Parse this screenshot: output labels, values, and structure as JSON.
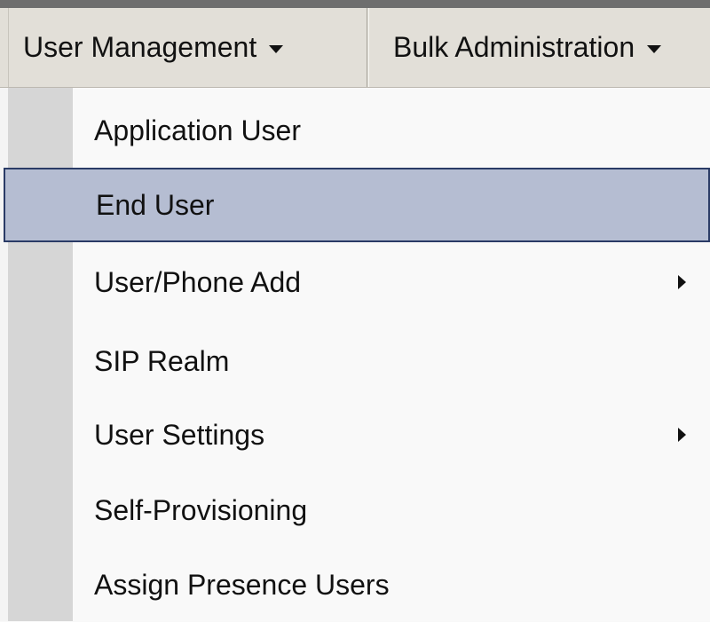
{
  "menubar": {
    "items": [
      {
        "label": "User Management",
        "has_caret": true,
        "active": true
      },
      {
        "label": "Bulk Administration",
        "has_caret": true,
        "active": false
      }
    ]
  },
  "dropdown": {
    "items": [
      {
        "label": "Application User",
        "highlighted": false,
        "has_submenu": false
      },
      {
        "label": "End User",
        "highlighted": true,
        "has_submenu": false
      },
      {
        "label": "User/Phone Add",
        "highlighted": false,
        "has_submenu": true
      },
      {
        "label": "SIP Realm",
        "highlighted": false,
        "has_submenu": false
      },
      {
        "label": "User Settings",
        "highlighted": false,
        "has_submenu": true
      },
      {
        "label": "Self-Provisioning",
        "highlighted": false,
        "has_submenu": false
      },
      {
        "label": "Assign Presence Users",
        "highlighted": false,
        "has_submenu": false
      }
    ]
  },
  "colors": {
    "menubar_bg": "#e2dfd8",
    "highlight_bg": "#b5bdd2",
    "highlight_border": "#2a3b66",
    "gutter": "#d6d6d6",
    "dropdown_bg": "#f9f9f9"
  }
}
